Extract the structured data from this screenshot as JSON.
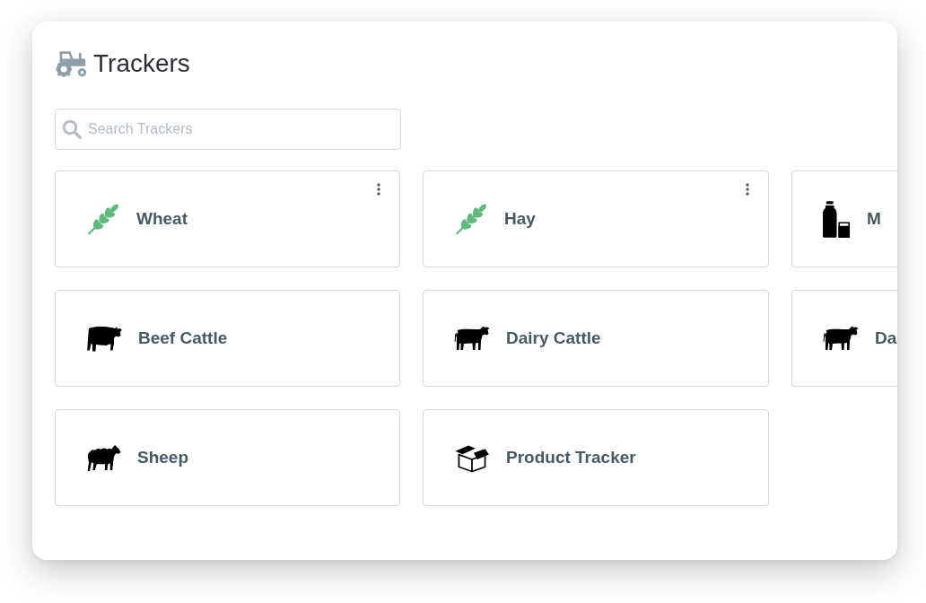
{
  "header": {
    "title": "Trackers"
  },
  "search": {
    "placeholder": "Search Trackers"
  },
  "trackers": [
    {
      "name": "Wheat",
      "kind": "grain",
      "menu": true
    },
    {
      "name": "Hay",
      "kind": "grain",
      "menu": true
    },
    {
      "name": "M",
      "kind": "milk",
      "menu": false
    },
    {
      "name": "Beef Cattle",
      "kind": "beef",
      "menu": false
    },
    {
      "name": "Dairy Cattle",
      "kind": "dairy",
      "menu": false
    },
    {
      "name": "Da",
      "kind": "dairy",
      "menu": false
    },
    {
      "name": "Sheep",
      "kind": "sheep",
      "menu": false
    },
    {
      "name": "Product Tracker",
      "kind": "product",
      "menu": false
    }
  ]
}
